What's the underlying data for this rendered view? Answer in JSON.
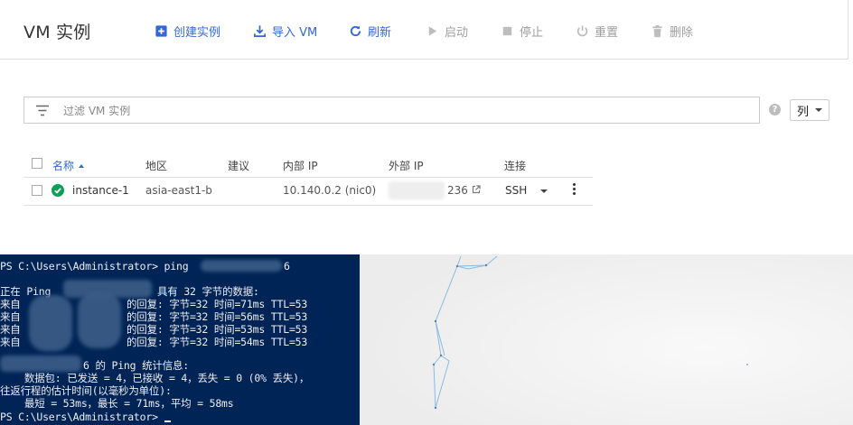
{
  "toolbar": {
    "title": "VM 实例",
    "buttons": [
      {
        "label": "创建实例",
        "icon": "add-box-icon",
        "state": "active"
      },
      {
        "label": "导入 VM",
        "icon": "import-icon",
        "state": "active"
      },
      {
        "label": "刷新",
        "icon": "refresh-icon",
        "state": "active"
      },
      {
        "label": "启动",
        "icon": "play-icon",
        "state": "disabled"
      },
      {
        "label": "停止",
        "icon": "stop-icon",
        "state": "disabled"
      },
      {
        "label": "重置",
        "icon": "power-icon",
        "state": "disabled"
      },
      {
        "label": "删除",
        "icon": "trash-icon",
        "state": "disabled"
      }
    ]
  },
  "filter": {
    "placeholder": "过滤 VM 实例",
    "columns_label": "列"
  },
  "table": {
    "headers": {
      "name": "名称",
      "zone": "地区",
      "recommendation": "建议",
      "internal_ip": "内部 IP",
      "external_ip": "外部 IP",
      "connect": "连接"
    },
    "rows": [
      {
        "name": "instance-1",
        "zone": "asia-east1-b",
        "recommendation": "",
        "internal_ip": "10.140.0.2 (nic0)",
        "external_ip_suffix": "236",
        "connect": "SSH",
        "status": "running"
      }
    ]
  },
  "terminal": {
    "lines": [
      "PS C:\\Users\\Administrator> ping",
      "6",
      "正在 Ping",
      "具有 32 字节的数据:",
      "来自",
      "的回复: 字节=32 时间=71ms TTL=53",
      "来自",
      "的回复: 字节=32 时间=56ms TTL=53",
      "来自",
      "的回复: 字节=32 时间=53ms TTL=53",
      "来自",
      "的回复: 字节=32 时间=54ms TTL=53",
      "6 的 Ping 统计信息:",
      "    数据包: 已发送 = 4，已接收 = 4，丢失 = 0 (0% 丢失)，",
      "往返行程的估计时间(以毫秒为单位):",
      "    最短 = 53ms，最长 = 71ms，平均 = 58ms",
      "PS C:\\Users\\Administrator> "
    ]
  },
  "colors": {
    "accent": "#3367d6",
    "status_ok": "#0f9d58",
    "terminal_bg": "#012456"
  }
}
